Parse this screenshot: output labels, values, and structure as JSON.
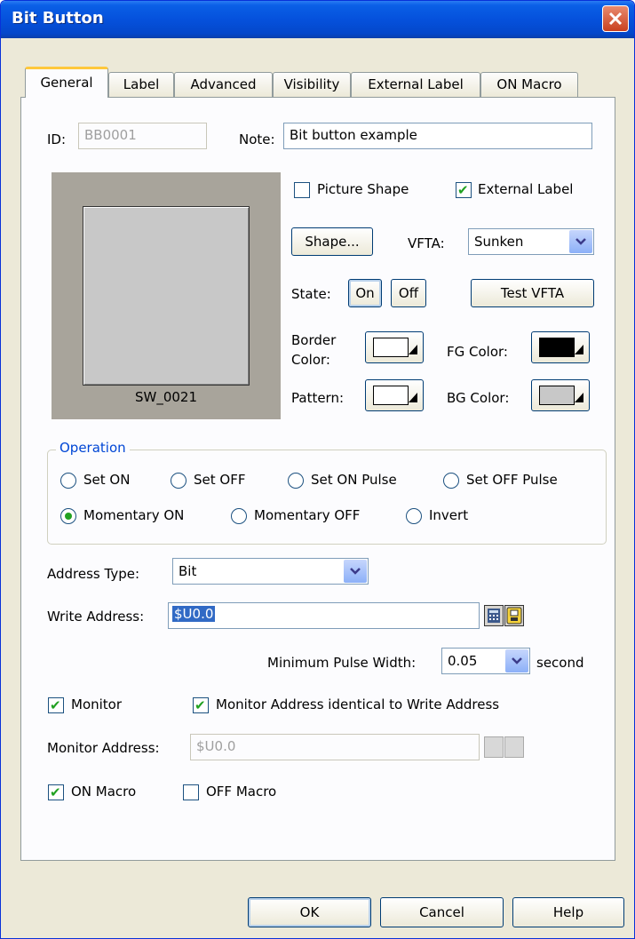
{
  "window": {
    "title": "Bit Button"
  },
  "tabs": [
    {
      "label": "General",
      "active": true
    },
    {
      "label": "Label"
    },
    {
      "label": "Advanced"
    },
    {
      "label": "Visibility"
    },
    {
      "label": "External Label"
    },
    {
      "label": "ON Macro"
    }
  ],
  "general": {
    "id_label": "ID:",
    "id_value": "BB0001",
    "note_label": "Note:",
    "note_value": "Bit button example",
    "preview_label": "SW_0021",
    "picture_shape_label": "Picture Shape",
    "picture_shape_checked": false,
    "external_label_label": "External Label",
    "external_label_checked": true,
    "shape_button": "Shape...",
    "vfta_label": "VFTA:",
    "vfta_value": "Sunken",
    "state_label": "State:",
    "state_on": "On",
    "state_off": "Off",
    "test_vfta_button": "Test VFTA",
    "border_color_label_1": "Border",
    "border_color_label_2": "Color:",
    "fg_color_label": "FG Color:",
    "pattern_label": "Pattern:",
    "bg_color_label": "BG Color:",
    "colors": {
      "border": "#ffffff",
      "fg": "#000000",
      "pattern": "#ffffff",
      "bg": "#c8c8c8"
    }
  },
  "operation": {
    "title": "Operation",
    "options": [
      {
        "label": "Set ON",
        "selected": false
      },
      {
        "label": "Set OFF",
        "selected": false
      },
      {
        "label": "Set ON Pulse",
        "selected": false
      },
      {
        "label": "Set OFF Pulse",
        "selected": false
      },
      {
        "label": "Momentary ON",
        "selected": true
      },
      {
        "label": "Momentary OFF",
        "selected": false
      },
      {
        "label": "Invert",
        "selected": false
      }
    ]
  },
  "address": {
    "type_label": "Address Type:",
    "type_value": "Bit",
    "write_label": "Write Address:",
    "write_value": "$U0.0",
    "min_pulse_label": "Minimum Pulse Width:",
    "min_pulse_value": "0.05",
    "min_pulse_unit": "second",
    "monitor_label": "Monitor",
    "monitor_checked": true,
    "monitor_identical_label": "Monitor Address identical to Write Address",
    "monitor_identical_checked": true,
    "monitor_address_label": "Monitor Address:",
    "monitor_address_value": "$U0.0"
  },
  "macros": {
    "on_macro_label": "ON Macro",
    "on_macro_checked": true,
    "off_macro_label": "OFF Macro",
    "off_macro_checked": false
  },
  "footer": {
    "ok": "OK",
    "cancel": "Cancel",
    "help": "Help"
  }
}
